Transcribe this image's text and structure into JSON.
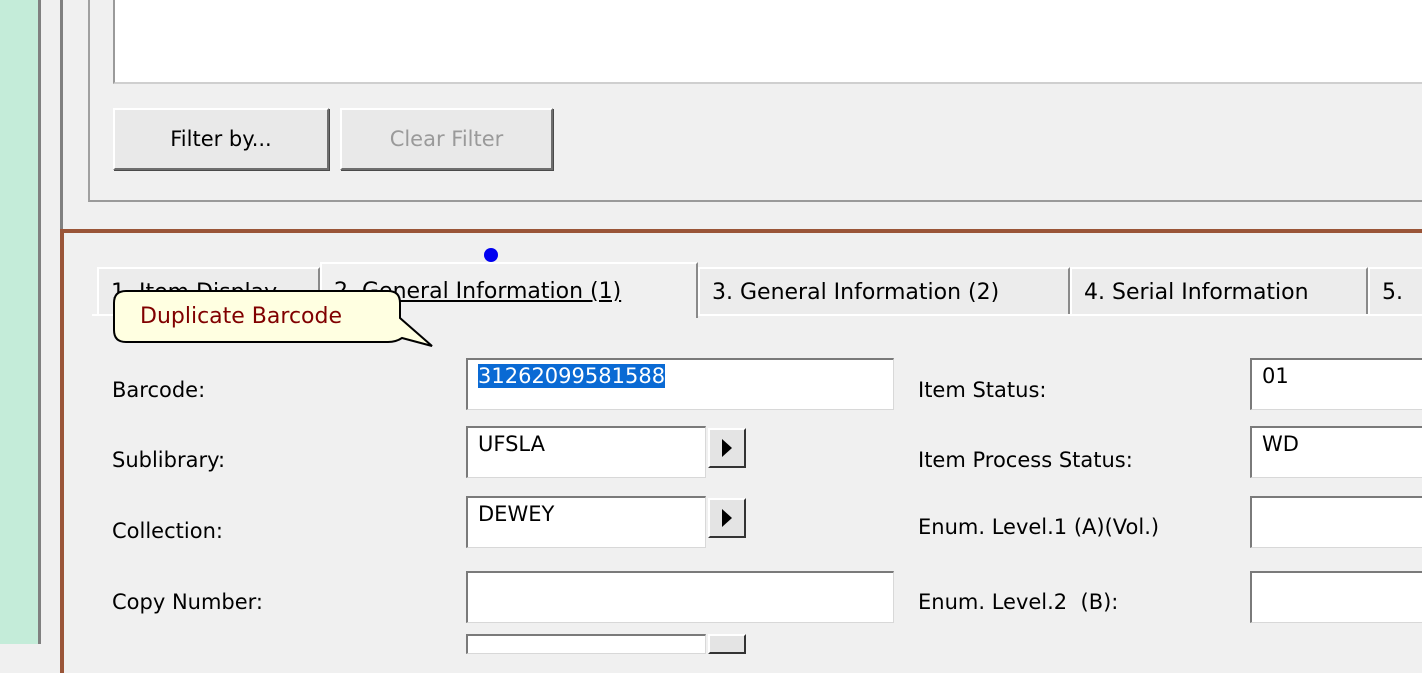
{
  "filter": {
    "filter_by_label": "Filter by...",
    "clear_filter_label": "Clear Filter"
  },
  "tabs": [
    {
      "label": "1. Item Display"
    },
    {
      "label": "2. General Information (1)"
    },
    {
      "label": "3. General Information (2)"
    },
    {
      "label": "4. Serial Information"
    },
    {
      "label": "5."
    }
  ],
  "active_tab_index": 1,
  "tooltip": {
    "text": "Duplicate Barcode"
  },
  "form": {
    "left": [
      {
        "label": "Barcode:",
        "value": "31262099581588"
      },
      {
        "label": "Sublibrary:",
        "value": "UFSLA"
      },
      {
        "label": "Collection:",
        "value": "DEWEY"
      },
      {
        "label": "Copy Number:",
        "value": ""
      }
    ],
    "right": [
      {
        "label": "Item Status:",
        "value": "01"
      },
      {
        "label": "Item Process Status:",
        "value": "WD"
      },
      {
        "label": "Enum. Level.1 (A)(Vol.)",
        "value": ""
      },
      {
        "label": "Enum. Level.2  (B):",
        "value": ""
      }
    ]
  },
  "colors": {
    "accent_border": "#9a5538",
    "selection": "#0a6ad4",
    "tooltip_text": "#800000",
    "left_strip": "#c4ecd9"
  }
}
